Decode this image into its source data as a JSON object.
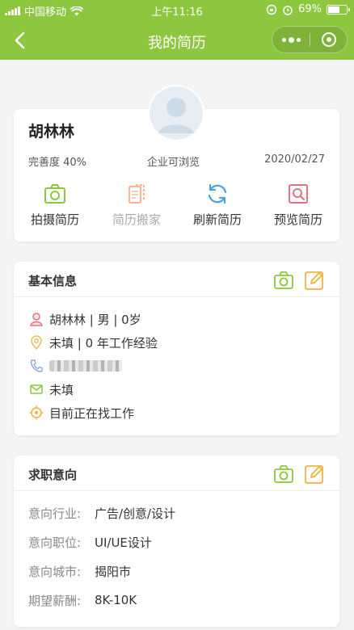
{
  "status_bar": {
    "carrier": "中国移动",
    "time": "上午11:16",
    "battery": "69%",
    "battery_level": 0.69
  },
  "nav": {
    "title": "我的简历"
  },
  "profile": {
    "name": "胡林林",
    "completeness": "完善度 40%",
    "visibility": "企业可浏览",
    "date": "2020/02/27",
    "actions": [
      {
        "label": "拍摄简历",
        "icon": "camera-icon",
        "color": "#8dc73f",
        "disabled": false
      },
      {
        "label": "简历搬家",
        "icon": "document-move-icon",
        "color": "#f2b896",
        "disabled": true
      },
      {
        "label": "刷新简历",
        "icon": "refresh-icon",
        "color": "#4aa3df",
        "disabled": false
      },
      {
        "label": "预览简历",
        "icon": "preview-icon",
        "color": "#e5737f",
        "disabled": false
      }
    ]
  },
  "basic_info": {
    "title": "基本信息",
    "summary": "胡林林 | 男 | 0岁",
    "location_experience": "未填 | 0 年工作经验",
    "email": "未填",
    "status": "目前正在找工作"
  },
  "job_intent": {
    "title": "求职意向",
    "rows": [
      {
        "key": "意向行业:",
        "value": "广告/创意/设计"
      },
      {
        "key": "意向职位:",
        "value": "UI/UE设计"
      },
      {
        "key": "意向城市:",
        "value": "揭阳市"
      },
      {
        "key": "期望薪酬:",
        "value": "8K-10K"
      }
    ]
  },
  "colors": {
    "brand": "#8dc73f",
    "edit": "#f0b43c",
    "page_bg": "#f4f4f4"
  }
}
